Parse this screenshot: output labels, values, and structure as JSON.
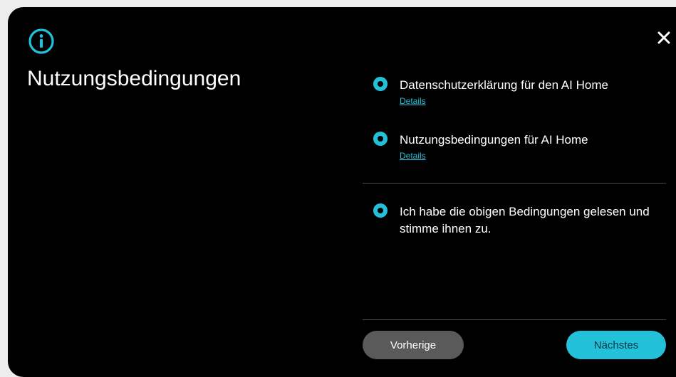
{
  "dialog": {
    "title": "Nutzungsbedingungen",
    "info_icon": "info-circle-icon",
    "close_icon": "close-x-icon"
  },
  "options": [
    {
      "label": "Datenschutzerklärung für den AI Home",
      "details_label": "Details",
      "selected": true
    },
    {
      "label": "Nutzungsbedingungen für AI Home",
      "details_label": "Details",
      "selected": true
    },
    {
      "label": "Ich habe die obigen Bedingungen gelesen und stimme ihnen zu.",
      "selected": true
    }
  ],
  "buttons": {
    "previous_label": "Vorherige",
    "next_label": "Nächstes"
  },
  "colors": {
    "accent": "#22c1d9",
    "background": "#000000",
    "secondary_button": "#5a5a5a",
    "page_background": "#ededed"
  }
}
